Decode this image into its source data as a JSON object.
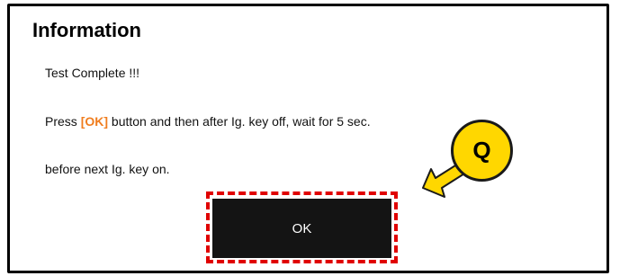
{
  "dialog": {
    "title": "Information",
    "message_line_1": "Test Complete !!!",
    "message_line_2_before": "Press ",
    "message_line_2_highlight": "[OK]",
    "message_line_2_after": " button and then after Ig. key off, wait for 5 sec.",
    "message_line_3": "before next Ig. key on.",
    "ok_button_label": "OK"
  },
  "annotation": {
    "callout_label": "Q",
    "callout_color": "#ffd700",
    "highlight_color": "#e00000"
  },
  "colors": {
    "highlight_text": "#f07d1e",
    "button_background": "#141414"
  }
}
